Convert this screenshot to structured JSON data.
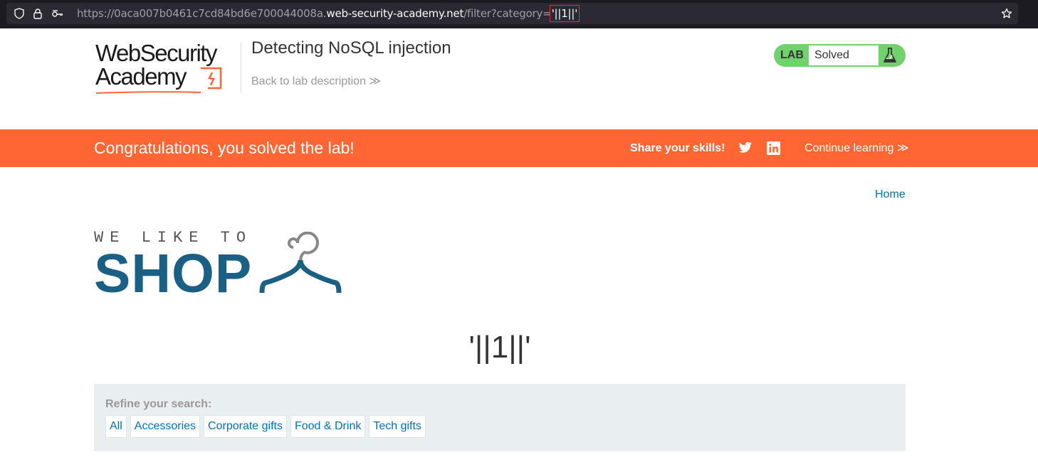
{
  "browser": {
    "url_prefix": "https://0aca007b0461c7cd84bd6e700044008a.",
    "url_domain": "web-security-academy.net",
    "url_path": "/filter?category=",
    "url_param": "'||1||'"
  },
  "header": {
    "logo_line1": "WebSecurity",
    "logo_line2": "Academy",
    "lab_title": "Detecting NoSQL injection",
    "back_link": "Back to lab description ≫",
    "lab_badge": "LAB",
    "lab_status": "Solved"
  },
  "banner": {
    "message": "Congratulations, you solved the lab!",
    "share": "Share your skills!",
    "continue": "Continue learning ≫"
  },
  "nav": {
    "home": "Home"
  },
  "shop_logo": {
    "tagline": "WE LIKE TO",
    "word": "SHOP"
  },
  "main": {
    "heading": "'||1||'"
  },
  "filters": {
    "label": "Refine your search:",
    "categories": [
      "All",
      "Accessories",
      "Corporate gifts",
      "Food & Drink",
      "Tech gifts"
    ]
  },
  "colors": {
    "banner": "#ff6633",
    "link": "#0071bc",
    "lab_solved": "#70d16d",
    "shop_blue": "#1a5f84"
  },
  "icons": [
    "shield-icon",
    "lock-icon",
    "key-icon",
    "star-icon",
    "flask-icon",
    "twitter-icon",
    "linkedin-icon",
    "hanger-icon"
  ]
}
